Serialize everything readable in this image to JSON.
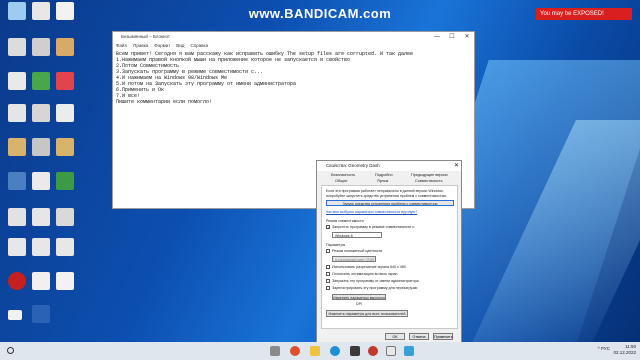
{
  "watermark": "www.BANDICAM.com",
  "yt_badge": "You may be EXPOSED!",
  "notepad": {
    "title": "Безымянный – Блокнот",
    "menu": [
      "Файл",
      "Правка",
      "Формат",
      "Вид",
      "Справка"
    ],
    "text": "Всем привет! Сегодня я вам расскажу как исправить ошибку The setup files are corrupted. И так далее\n1.Нажимаем правой кнопкой мыши на приложение которое не запускается и свойство\n2.Потом Совместимость\n3.Запускать программу в режиме совместимости с...\n4.И нажимаем на Windows 98/Windows Me\n5.И потом на Запускать эту программу от имени администратора\n6.Применить и Ок\n7.И все!\nПишите комментарии если помогло!"
  },
  "dialog": {
    "title": "Свойства: Geometry Dash",
    "tabs": [
      "Безопасность",
      "Подробно",
      "Предыдущие версии",
      "Общие",
      "Ярлык",
      "Совместимость"
    ],
    "intro": "Если эта программа работает неправильно в данной версии Windows, попробуйте запустить средство устранения проблем с совместимостью.",
    "troubleshoot_button": "Запуск средства устранения проблем с совместимостью",
    "manual_link": "Как мне выбрать параметры совместимости вручную?",
    "compat_mode_header": "Режим совместимости",
    "compat_mode_checkbox": "Запустить программу в режиме совместимости с:",
    "compat_select": "Windows 8",
    "params_header": "Параметры",
    "reduced_color": "Режим пониженной цветности",
    "color_select": "8-разрядный цвет (256)",
    "res_640": "Использовать разрешение экрана 640 x 480",
    "disable_fullscreen": "Отключить оптимизацию во весь экран",
    "run_as_admin": "Запускать эту программу от имени администратора",
    "register_restart": "Зарегистрировать эту программу для перезагрузки",
    "dpi_button": "Изменить параметры высокого DPI",
    "all_users_button": "Изменить параметры для всех пользователей",
    "ok": "ОК",
    "cancel": "Отмена",
    "apply": "Применить"
  },
  "taskbar": {
    "tray": "^ РУС",
    "time": "11:50",
    "date": "02.12.2022"
  }
}
